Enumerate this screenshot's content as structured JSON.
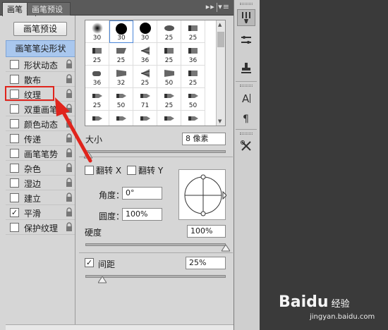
{
  "tabs": [
    {
      "label": "画笔",
      "active": true
    },
    {
      "label": "画笔预设",
      "active": false
    }
  ],
  "tabbar_menu": "▸▸ ▾≡",
  "left": {
    "preset_button": "画笔预设",
    "tip_header": "画笔笔尖形状",
    "options": [
      {
        "label": "形状动态",
        "checked": false
      },
      {
        "label": "散布",
        "checked": false
      },
      {
        "label": "纹理",
        "checked": false
      },
      {
        "label": "双重画笔",
        "checked": false
      },
      {
        "label": "颜色动态",
        "checked": false
      },
      {
        "label": "传递",
        "checked": false
      },
      {
        "label": "画笔笔势",
        "checked": false
      },
      {
        "label": "杂色",
        "checked": false
      },
      {
        "label": "湿边",
        "checked": false
      },
      {
        "label": "建立",
        "checked": false
      },
      {
        "label": "平滑",
        "checked": true
      },
      {
        "label": "保护纹理",
        "checked": false
      }
    ]
  },
  "brush_grid": {
    "rows": [
      [
        {
          "kind": "soft",
          "size": "30"
        },
        {
          "kind": "hard",
          "size": "30",
          "selected": true
        },
        {
          "kind": "hard",
          "size": "30"
        },
        {
          "kind": "leaf",
          "size": "25"
        },
        {
          "kind": "flat",
          "size": "25"
        }
      ],
      [
        {
          "kind": "flat",
          "size": "25"
        },
        {
          "kind": "angled",
          "size": "25"
        },
        {
          "kind": "fan",
          "size": "36"
        },
        {
          "kind": "flat",
          "size": "25"
        },
        {
          "kind": "flat",
          "size": "36"
        }
      ],
      [
        {
          "kind": "round",
          "size": "36"
        },
        {
          "kind": "wedge",
          "size": "32"
        },
        {
          "kind": "fan",
          "size": "25"
        },
        {
          "kind": "wedge",
          "size": "50"
        },
        {
          "kind": "flat",
          "size": "25"
        }
      ],
      [
        {
          "kind": "pen",
          "size": "25"
        },
        {
          "kind": "pen",
          "size": "50"
        },
        {
          "kind": "pen",
          "size": "71"
        },
        {
          "kind": "pen",
          "size": "25"
        },
        {
          "kind": "pen",
          "size": "50"
        }
      ],
      [
        {
          "kind": "pen",
          "size": ""
        },
        {
          "kind": "pen",
          "size": ""
        },
        {
          "kind": "pen",
          "size": ""
        },
        {
          "kind": "pen",
          "size": ""
        },
        {
          "kind": "pen",
          "size": ""
        }
      ]
    ]
  },
  "size": {
    "label": "大小",
    "value": "8 像素",
    "level": 0.02
  },
  "flip_x": {
    "label": "翻转 X",
    "checked": false
  },
  "flip_y": {
    "label": "翻转 Y",
    "checked": false
  },
  "angle": {
    "label": "角度：",
    "value": "0°"
  },
  "roundness": {
    "label": "圆度：",
    "value": "100%"
  },
  "hardness": {
    "label": "硬度",
    "value": "100%",
    "level": 1.0
  },
  "spacing": {
    "label": "间距",
    "value": "25%",
    "checked": true,
    "level": 0.12
  },
  "right_panel": {
    "buttons": [
      "brush-settings-icon",
      "brush-presets-icon",
      "clone-stamp-icon",
      "character-icon",
      "paragraph-icon",
      "tool-presets-icon"
    ]
  },
  "watermark": {
    "brand": "Baidu",
    "jy": "经验",
    "url": "jingyan.baidu.com"
  },
  "colors": {
    "highlight": "#e0241c",
    "arrow": "#e0241c",
    "selected_tip": "#a9c7ee"
  }
}
